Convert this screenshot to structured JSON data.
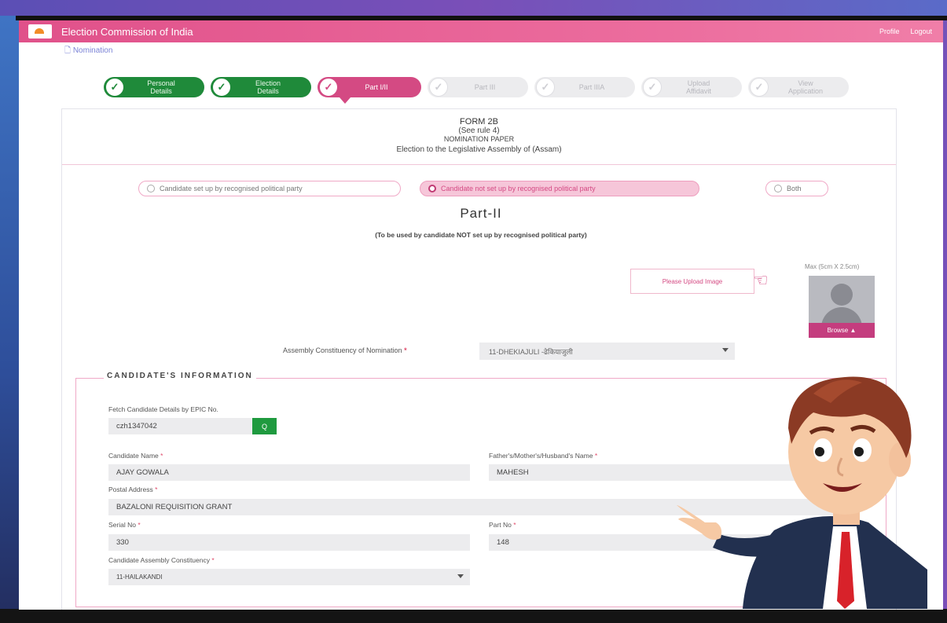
{
  "app": {
    "title": "Election Commission of India",
    "profile": "Profile",
    "logout": "Logout"
  },
  "breadcrumb": {
    "label": "Nomination"
  },
  "steps": [
    {
      "label": "Personal Details",
      "state": "done"
    },
    {
      "label": "Election Details",
      "state": "done"
    },
    {
      "label": "Part I/II",
      "state": "active"
    },
    {
      "label": "Part III",
      "state": "todo"
    },
    {
      "label": "Part IIIA",
      "state": "todo"
    },
    {
      "label": "Upload Affidavit",
      "state": "todo"
    },
    {
      "label": "View Application",
      "state": "todo"
    }
  ],
  "form": {
    "title": "FORM 2B",
    "rule": "(See rule 4)",
    "paper": "NOMINATION PAPER",
    "election": "Election to the Legislative Assembly of (Assam)"
  },
  "candidate_type": {
    "options": [
      "Candidate set up by recognised political party",
      "Candidate not set up by recognised political party",
      "Both"
    ],
    "selected": "Candidate not set up by recognised political party"
  },
  "part": {
    "title": "Part-II",
    "subtitle": "(To be used by candidate NOT set up by recognised political party)"
  },
  "photo": {
    "size_note": "Max (5cm X 2.5cm)",
    "upload_note": "Please Upload Image",
    "browse_label": "Browse"
  },
  "assembly": {
    "label": "Assembly Constituency of Nomination",
    "value": "11-DHEKIAJULI -ढेकियाजुली"
  },
  "candidate_info": {
    "legend": "CANDIDATE'S INFORMATION",
    "fetch_label": "Fetch Candidate Details by EPIC No.",
    "epic_value": "czh1347042",
    "fetch_button": "Q",
    "name_label": "Candidate Name",
    "name_value": "AJAY GOWALA",
    "relative_label": "Father's/Mother's/Husband's Name",
    "relative_value": "MAHESH",
    "address_label": "Postal Address",
    "address_value": "BAZALONI REQUISITION GRANT",
    "serial_label": "Serial No",
    "serial_value": "330",
    "partno_label": "Part No",
    "partno_value": "148",
    "cac_label": "Candidate Assembly Constituency",
    "cac_value": "11-HAILAKANDI"
  },
  "required_mark": "*",
  "colors": {
    "accent": "#d44a83",
    "done": "#1f8a3a",
    "topbar": "#e0518a"
  }
}
